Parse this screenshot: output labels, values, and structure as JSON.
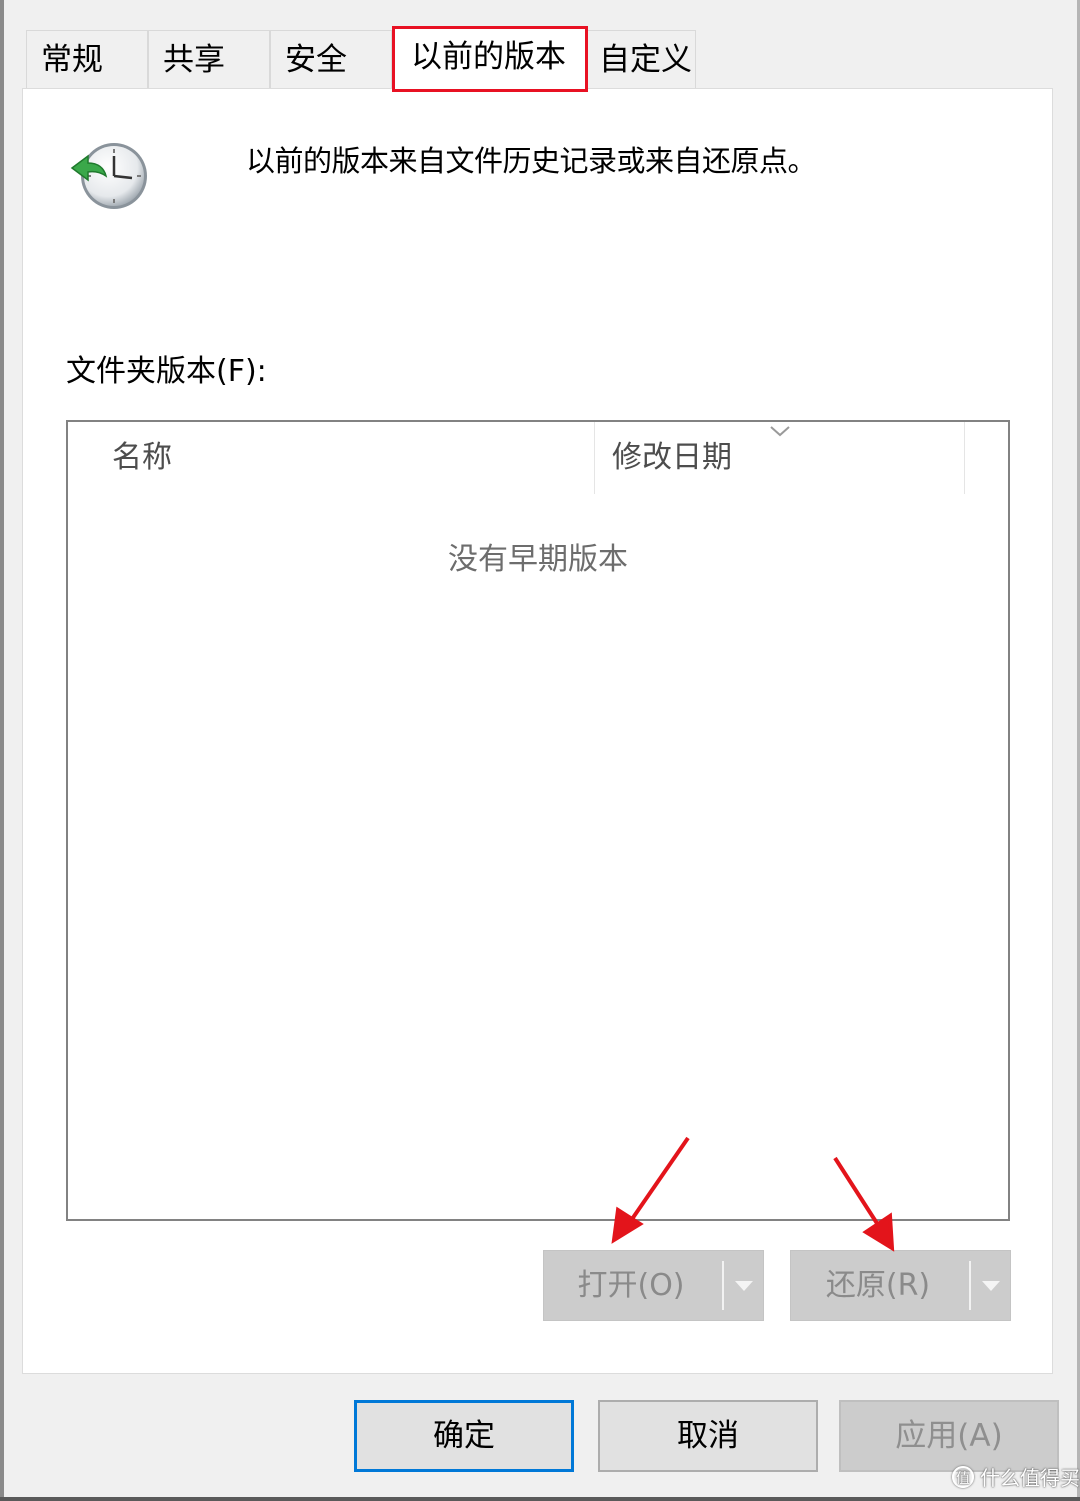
{
  "tabs": [
    {
      "label": "常规"
    },
    {
      "label": "共享"
    },
    {
      "label": "安全"
    },
    {
      "label": "以前的版本",
      "active": true
    },
    {
      "label": "自定义"
    }
  ],
  "info": {
    "icon": "restore-clock-icon",
    "text": "以前的版本来自文件历史记录或来自还原点。"
  },
  "versions_list": {
    "label": "文件夹版本(F):",
    "columns": [
      "名称",
      "修改日期"
    ],
    "empty_message": "没有早期版本"
  },
  "actions": {
    "open_label": "打开(O)",
    "restore_label": "还原(R)"
  },
  "dialog_buttons": {
    "ok_label": "确定",
    "cancel_label": "取消",
    "apply_label": "应用(A)"
  },
  "watermark": {
    "icon_char": "值",
    "text": "什么值得买"
  },
  "colors": {
    "highlight_red": "#e81123",
    "focus_blue": "#0078d7",
    "annotation_arrow": "#e3141b"
  }
}
